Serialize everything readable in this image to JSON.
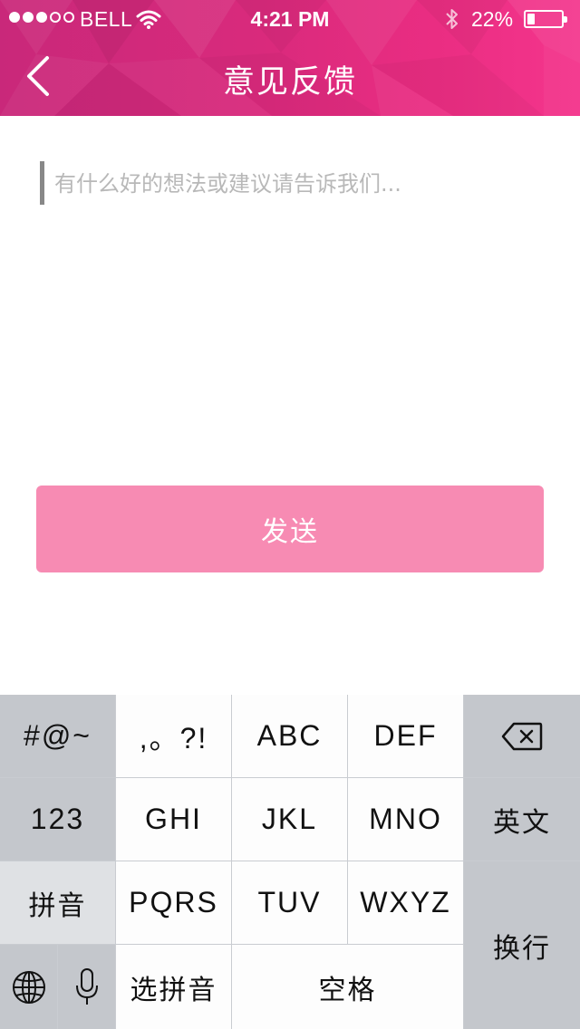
{
  "status_bar": {
    "carrier": "BELL",
    "time": "4:21 PM",
    "battery_percent": "22%",
    "battery_level": 0.22,
    "signal_bars": 3,
    "signal_max": 5,
    "icons": [
      "wifi-icon",
      "bluetooth-icon",
      "battery-icon"
    ]
  },
  "nav": {
    "title": "意见反馈",
    "back_icon": "chevron-left-icon"
  },
  "feedback": {
    "placeholder": "有什么好的想法或建议请告诉我们...",
    "value": ""
  },
  "send_button": {
    "label": "发送",
    "color": "#f78bb3"
  },
  "keyboard": {
    "keys": {
      "symbols": "#@~",
      "punct": ",。?!",
      "abc": "ABC",
      "def": "DEF",
      "num": "123",
      "ghi": "GHI",
      "jkl": "JKL",
      "mno": "MNO",
      "english": "英文",
      "pinyin": "拼音",
      "pqrs": "PQRS",
      "tuv": "TUV",
      "wxyz": "WXYZ",
      "select_pinyin": "选拼音",
      "space": "空格",
      "newline": "换行"
    },
    "icons": [
      "backspace-icon",
      "globe-icon",
      "microphone-icon"
    ]
  },
  "colors": {
    "header_gradient_start": "#c9287a",
    "header_gradient_end": "#f4358c",
    "keyboard_background": "#c9ccd1"
  }
}
